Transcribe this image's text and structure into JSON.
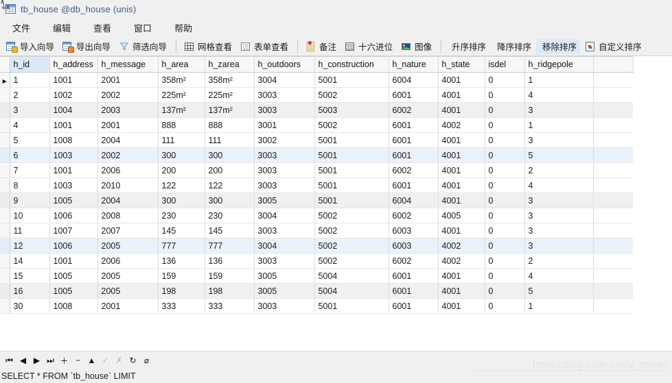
{
  "window": {
    "title": "tb_house @db_house (unis)",
    "icon": "table-icon"
  },
  "menu": {
    "items": [
      {
        "label": "文件",
        "name": "menu-file"
      },
      {
        "label": "编辑",
        "name": "menu-edit"
      },
      {
        "label": "查看",
        "name": "menu-view"
      },
      {
        "label": "窗口",
        "name": "menu-window"
      },
      {
        "label": "帮助",
        "name": "menu-help"
      }
    ]
  },
  "toolbar": {
    "groups": [
      {
        "buttons": [
          {
            "label": "导入向导",
            "icon": "import-wizard-icon"
          },
          {
            "label": "导出向导",
            "icon": "export-wizard-icon"
          },
          {
            "label": "筛选向导",
            "icon": "filter-wizard-icon"
          }
        ]
      },
      {
        "buttons": [
          {
            "label": "网格查看",
            "icon": "grid-view-icon"
          },
          {
            "label": "表单查看",
            "icon": "form-view-icon"
          }
        ]
      },
      {
        "buttons": [
          {
            "label": "备注",
            "icon": "memo-icon"
          },
          {
            "label": "十六进位",
            "icon": "hex-icon"
          },
          {
            "label": "图像",
            "icon": "image-icon"
          }
        ]
      },
      {
        "buttons": [
          {
            "label": "升序排序",
            "icon": "sort-ascending-icon"
          },
          {
            "label": "降序排序",
            "icon": "sort-descending-icon"
          },
          {
            "label": "移除排序",
            "icon": "remove-sort-icon"
          },
          {
            "label": "自定义排序",
            "icon": "custom-sort-icon"
          }
        ]
      }
    ]
  },
  "grid": {
    "selected_column": "h_id",
    "current_row_index": 0,
    "columns": [
      "h_id",
      "h_address",
      "h_message",
      "h_area",
      "h_zarea",
      "h_outdoors",
      "h_construction",
      "h_nature",
      "h_state",
      "isdel",
      "h_ridgepole"
    ],
    "rows": [
      {
        "style": "normal",
        "cells": [
          "1",
          "1001",
          "2001",
          "358m²",
          "358m²",
          "3004",
          "5001",
          "6004",
          "4001",
          "0",
          "1"
        ]
      },
      {
        "style": "normal",
        "cells": [
          "2",
          "1002",
          "2002",
          "225m²",
          "225m²",
          "3003",
          "5002",
          "6001",
          "4001",
          "0",
          "4"
        ]
      },
      {
        "style": "alt",
        "cells": [
          "3",
          "1004",
          "2003",
          "137m²",
          "137m²",
          "3003",
          "5003",
          "6002",
          "4001",
          "0",
          "3"
        ]
      },
      {
        "style": "normal",
        "cells": [
          "4",
          "1001",
          "2001",
          "888",
          "888",
          "3001",
          "5002",
          "6001",
          "4002",
          "0",
          "1"
        ]
      },
      {
        "style": "normal",
        "cells": [
          "5",
          "1008",
          "2004",
          "111",
          "111",
          "3002",
          "5001",
          "6001",
          "4001",
          "0",
          "3"
        ]
      },
      {
        "style": "hl",
        "cells": [
          "6",
          "1003",
          "2002",
          "300",
          "300",
          "3003",
          "5001",
          "6001",
          "4001",
          "0",
          "5"
        ]
      },
      {
        "style": "normal",
        "cells": [
          "7",
          "1001",
          "2006",
          "200",
          "200",
          "3003",
          "5001",
          "6002",
          "4001",
          "0",
          "2"
        ]
      },
      {
        "style": "normal",
        "cells": [
          "8",
          "1003",
          "2010",
          "122",
          "122",
          "3003",
          "5001",
          "6001",
          "4001",
          "0",
          "4"
        ]
      },
      {
        "style": "alt",
        "cells": [
          "9",
          "1005",
          "2004",
          "300",
          "300",
          "3005",
          "5001",
          "6004",
          "4001",
          "0",
          "3"
        ]
      },
      {
        "style": "normal",
        "cells": [
          "10",
          "1006",
          "2008",
          "230",
          "230",
          "3004",
          "5002",
          "6002",
          "4005",
          "0",
          "3"
        ]
      },
      {
        "style": "normal",
        "cells": [
          "11",
          "1007",
          "2007",
          "145",
          "145",
          "3003",
          "5002",
          "6003",
          "4001",
          "0",
          "3"
        ]
      },
      {
        "style": "hl",
        "cells": [
          "12",
          "1006",
          "2005",
          "777",
          "777",
          "3004",
          "5002",
          "6003",
          "4002",
          "0",
          "3"
        ]
      },
      {
        "style": "normal",
        "cells": [
          "14",
          "1001",
          "2006",
          "136",
          "136",
          "3003",
          "5002",
          "6002",
          "4002",
          "0",
          "2"
        ]
      },
      {
        "style": "normal",
        "cells": [
          "15",
          "1005",
          "2005",
          "159",
          "159",
          "3005",
          "5004",
          "6001",
          "4001",
          "0",
          "4"
        ]
      },
      {
        "style": "alt",
        "cells": [
          "16",
          "1005",
          "2005",
          "198",
          "198",
          "3005",
          "5004",
          "6001",
          "4001",
          "0",
          "5"
        ]
      },
      {
        "style": "normal",
        "cells": [
          "30",
          "1008",
          "2001",
          "333",
          "333",
          "3003",
          "5001",
          "6001",
          "4001",
          "0",
          "1"
        ]
      }
    ]
  },
  "navbar": {
    "buttons": [
      {
        "name": "first-record-button",
        "glyph": "⏮",
        "enabled": true
      },
      {
        "name": "previous-record-button",
        "glyph": "◀",
        "enabled": true
      },
      {
        "name": "next-record-button",
        "glyph": "▶",
        "enabled": true
      },
      {
        "name": "last-record-button",
        "glyph": "⏭",
        "enabled": true
      },
      {
        "name": "add-record-button",
        "glyph": "＋",
        "enabled": true
      },
      {
        "name": "delete-record-button",
        "glyph": "−",
        "enabled": true
      },
      {
        "name": "edit-record-button",
        "glyph": "▲",
        "enabled": true
      },
      {
        "name": "apply-changes-button",
        "glyph": "✓",
        "enabled": false
      },
      {
        "name": "discard-changes-button",
        "glyph": "✗",
        "enabled": false
      },
      {
        "name": "refresh-button",
        "glyph": "↻",
        "enabled": true
      },
      {
        "name": "stop-button",
        "glyph": "⌀",
        "enabled": true
      }
    ]
  },
  "statusbar": {
    "query": "SELECT * FROM `tb_house` LIMIT"
  },
  "watermark": {
    "text": "https://blog.csdn.net/V_99999"
  },
  "colors": {
    "chrome": "#f0f0f0",
    "title_text": "#3a5a8a",
    "header_selected": "#dbe9f7",
    "row_alt": "#f0f0f0",
    "row_highlight": "#eaf2fb",
    "grid_line": "#dcdcdc"
  }
}
